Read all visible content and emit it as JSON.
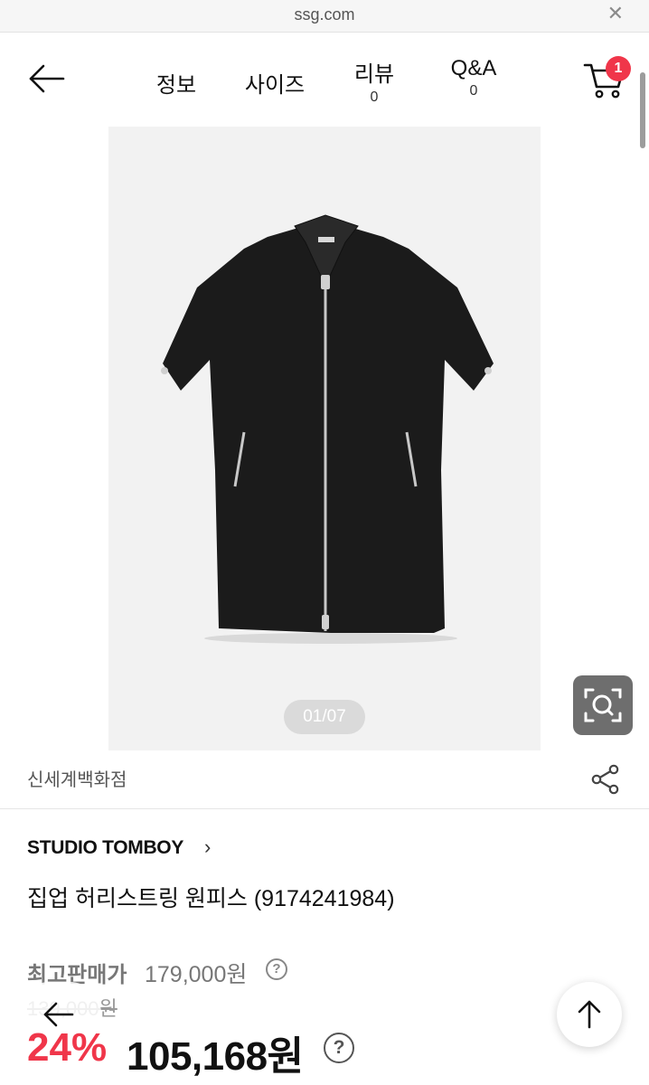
{
  "browser": {
    "url": "ssg.com",
    "close_icon": "close-icon"
  },
  "header": {
    "tabs": [
      {
        "label": "정보"
      },
      {
        "label": "사이즈"
      },
      {
        "label": "리뷰",
        "count": "0"
      },
      {
        "label": "Q&A",
        "count": "0"
      }
    ],
    "cart_badge": "1"
  },
  "gallery": {
    "pager": "01/07"
  },
  "store": {
    "name": "신세계백화점"
  },
  "product": {
    "brand": "STUDIO TOMBOY",
    "brand_chevron": "›",
    "name": "집업 허리스트링 원피스 (9174241984)",
    "best_price_label": "최고판매가",
    "best_price": "179,000원",
    "original_price": "139,000원",
    "discount": "24%",
    "price": "105,168원",
    "help_glyph": "?"
  },
  "colors": {
    "accent": "#f0364a",
    "badge": "#f0364a"
  }
}
